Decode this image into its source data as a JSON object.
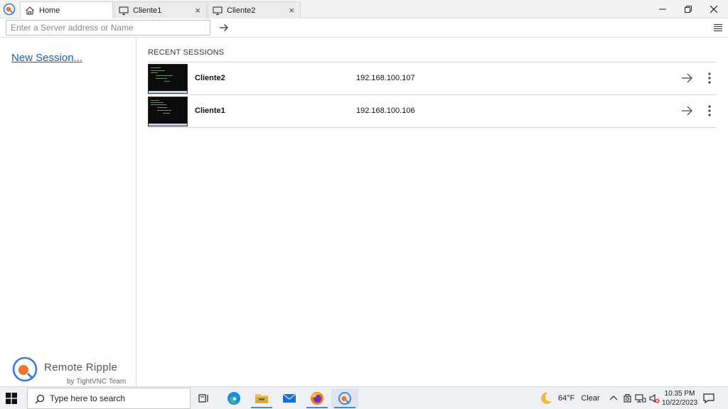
{
  "window": {
    "tabs": [
      {
        "label": "Home",
        "icon": "home-icon"
      },
      {
        "label": "Cliente1",
        "icon": "monitor-icon"
      },
      {
        "label": "Cliente2",
        "icon": "monitor-icon"
      }
    ]
  },
  "address": {
    "placeholder": "Enter a Server address or Name"
  },
  "sidebar": {
    "new_session": "New Session...",
    "brand_name": "Remote Ripple",
    "brand_by": "by TightVNC Team"
  },
  "main": {
    "section_title": "RECENT SESSIONS",
    "sessions": [
      {
        "name": "Cliente2",
        "address": "192.168.100.107"
      },
      {
        "name": "Cliente1",
        "address": "192.168.100.106"
      }
    ]
  },
  "taskbar": {
    "search_text": "Type here to search",
    "weather_temp": "64°F",
    "weather_desc": "Clear",
    "time": "10:35 PM",
    "date": "10/22/2023"
  },
  "colors": {
    "accent": "#1a5fb4",
    "brand_orange": "#f0742e",
    "brand_blue": "#3a7bd5"
  }
}
